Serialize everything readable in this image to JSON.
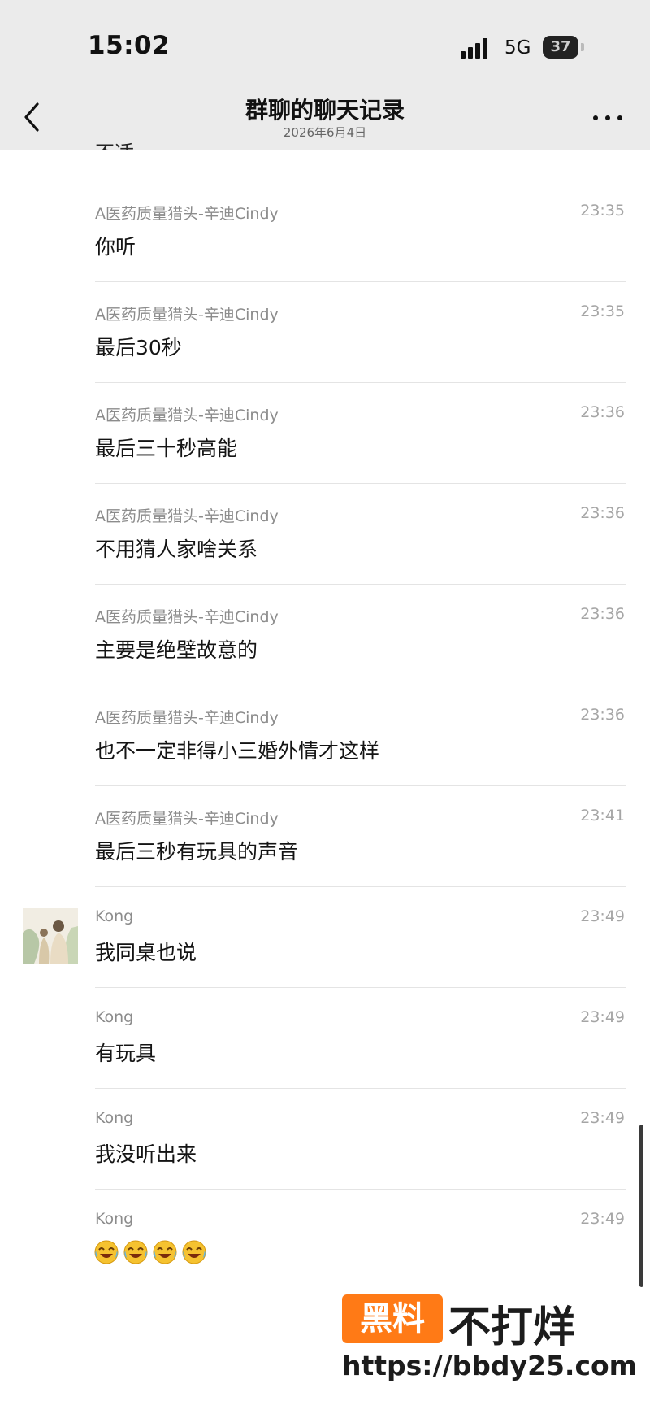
{
  "status_bar": {
    "time": "15:02",
    "network": "5G",
    "battery": "37"
  },
  "nav": {
    "back_icon": "chevron-left-icon",
    "title": "群聊的聊天记录",
    "subtitle": "2026年6月4日",
    "more_icon": "more-dots-icon"
  },
  "cut_message": "不适",
  "messages": [
    {
      "sender": "A医药质量猎头-辛迪Cindy",
      "time": "23:35",
      "text": "你听"
    },
    {
      "sender": "A医药质量猎头-辛迪Cindy",
      "time": "23:35",
      "text": "最后30秒"
    },
    {
      "sender": "A医药质量猎头-辛迪Cindy",
      "time": "23:36",
      "text": "最后三十秒高能"
    },
    {
      "sender": "A医药质量猎头-辛迪Cindy",
      "time": "23:36",
      "text": "不用猜人家啥关系"
    },
    {
      "sender": "A医药质量猎头-辛迪Cindy",
      "time": "23:36",
      "text": "主要是绝壁故意的"
    },
    {
      "sender": "A医药质量猎头-辛迪Cindy",
      "time": "23:36",
      "text": "也不一定非得小三婚外情才这样"
    },
    {
      "sender": "A医药质量猎头-辛迪Cindy",
      "time": "23:41",
      "text": "最后三秒有玩具的声音"
    },
    {
      "sender": "Kong",
      "time": "23:49",
      "text": "我同桌也说"
    },
    {
      "sender": "Kong",
      "time": "23:49",
      "text": "有玩具"
    },
    {
      "sender": "Kong",
      "time": "23:49",
      "text": "我没听出来"
    },
    {
      "sender": "Kong",
      "time": "23:49",
      "emoji": "laughing-crying-emoji",
      "emoji_count": 4
    }
  ],
  "watermark": {
    "logo": "黑料",
    "text": "不打烊",
    "url": "https://bbdy25.com"
  },
  "colors": {
    "header_bg": "#ebebeb",
    "watermark_orange": "#ff7a16"
  }
}
